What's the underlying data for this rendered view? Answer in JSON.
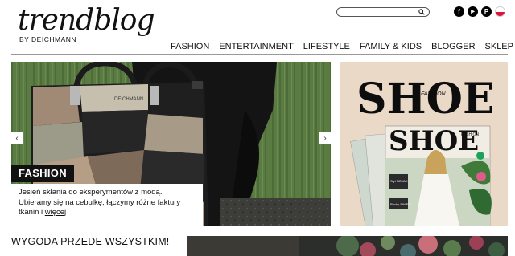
{
  "brand": {
    "logo": "trendblog",
    "sub": "BY DEICHMANN"
  },
  "search": {
    "placeholder": "",
    "icon": "search-icon"
  },
  "social": [
    {
      "name": "facebook",
      "glyph": "f"
    },
    {
      "name": "youtube",
      "glyph": "▶"
    },
    {
      "name": "pinterest",
      "glyph": "P"
    }
  ],
  "nav": {
    "items": [
      "FASHION",
      "ENTERTAINMENT",
      "LIFESTYLE",
      "FAMILY & KIDS",
      "BLOGGER",
      "SKLEP"
    ]
  },
  "hero": {
    "category": "FASHION",
    "caption": "Jesień skłania do eksperymentów z modą. Ubieramy się na cebulkę, łączymy różne faktury tkanin i ",
    "more": "więcej",
    "bag_label": "DEICHMANN"
  },
  "magazine": {
    "title": "SHOE",
    "title_sub": "FASHION",
    "cover_title": "SHOE",
    "cover_sub": "FASHION",
    "cover_side": "Styl NOVAK",
    "cover_side2": "Rocky SWIFT"
  },
  "section": {
    "title": "WYGODA PRZEDE WSZYSTKIM!"
  },
  "colors": {
    "accent": "#111111",
    "wall": "#5c7d44",
    "magazine_bg": "#ead9c7"
  }
}
